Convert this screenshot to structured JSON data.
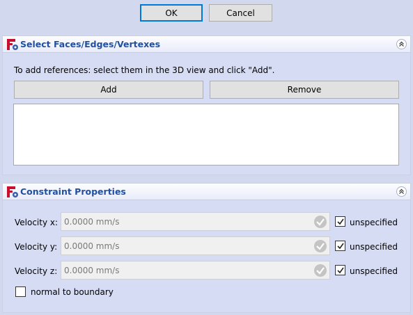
{
  "dialog": {
    "ok_label": "OK",
    "cancel_label": "Cancel"
  },
  "selection_panel": {
    "title": "Select Faces/Edges/Vertexes",
    "hint": "To add references: select them in the 3D view  and click \"Add\".",
    "add_label": "Add",
    "remove_label": "Remove",
    "references": []
  },
  "constraint_panel": {
    "title": "Constraint Properties",
    "rows": [
      {
        "label": "Velocity x:",
        "placeholder": "0.0000 mm/s",
        "checkbox_label": "unspecified",
        "checked": true
      },
      {
        "label": "Velocity y:",
        "placeholder": "0.0000 mm/s",
        "checkbox_label": "unspecified",
        "checked": true
      },
      {
        "label": "Velocity z:",
        "placeholder": "0.0000 mm/s",
        "checkbox_label": "unspecified",
        "checked": true
      }
    ],
    "normal_to_boundary_label": "normal to boundary",
    "normal_to_boundary_checked": false
  },
  "icons": {
    "panel_logo": "freecad-fem-icon",
    "collapse": "collapse-chevron-up-icon",
    "input_valid": "check-valid-icon"
  },
  "colors": {
    "panel_title": "#2150a0",
    "background": "#d2d9ef",
    "default_button_border": "#0078d7"
  }
}
